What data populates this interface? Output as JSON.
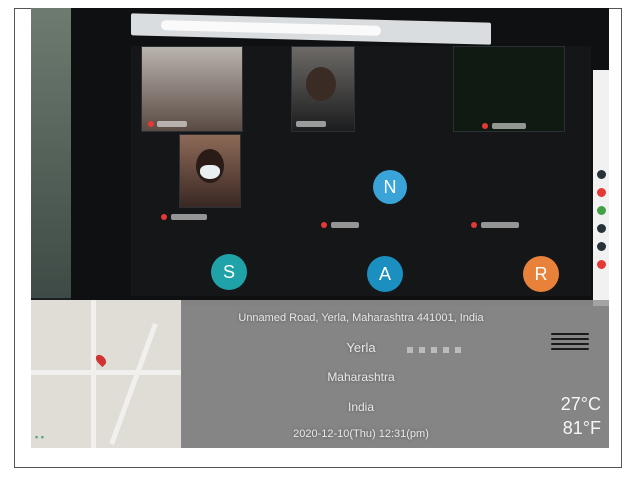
{
  "video_call": {
    "avatars": [
      {
        "letter": "N",
        "color": "#3aa3d8"
      },
      {
        "letter": "S",
        "color": "#1fa3a8"
      },
      {
        "letter": "A",
        "color": "#1b8fbf"
      },
      {
        "letter": "R",
        "color": "#e8823a"
      }
    ]
  },
  "geotag": {
    "address": "Unnamed Road, Yerla, Maharashtra 441001, India",
    "locality": "Yerla",
    "state": "Maharashtra",
    "country": "India",
    "datetime": "2020-12-10(Thu)  12:31(pm)",
    "temp_c": "27°C",
    "temp_f": "81°F",
    "weather_icon": "fog-icon"
  }
}
